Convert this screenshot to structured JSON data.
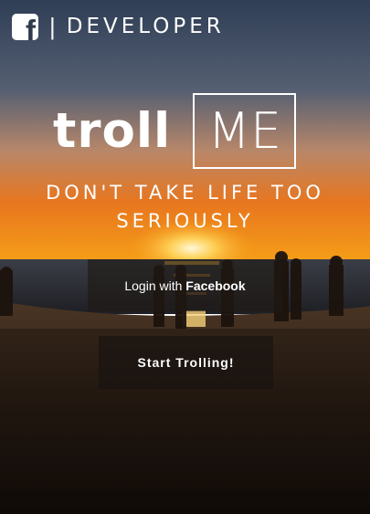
{
  "header": {
    "icon": "facebook-icon",
    "icon_glyph": "f",
    "separator": "|",
    "title": "DEVELOPER"
  },
  "logo": {
    "left": "troll",
    "boxed": "ME"
  },
  "tagline": "DON'T TAKE LIFE TOO SERIOUSLY",
  "buttons": {
    "login_prefix": "Login with ",
    "login_bold": "Facebook",
    "start": "Start Trolling!"
  },
  "colors": {
    "sky_top": "#2f3e56",
    "sunset": "#f08a1e",
    "sun": "#fff6d0"
  }
}
